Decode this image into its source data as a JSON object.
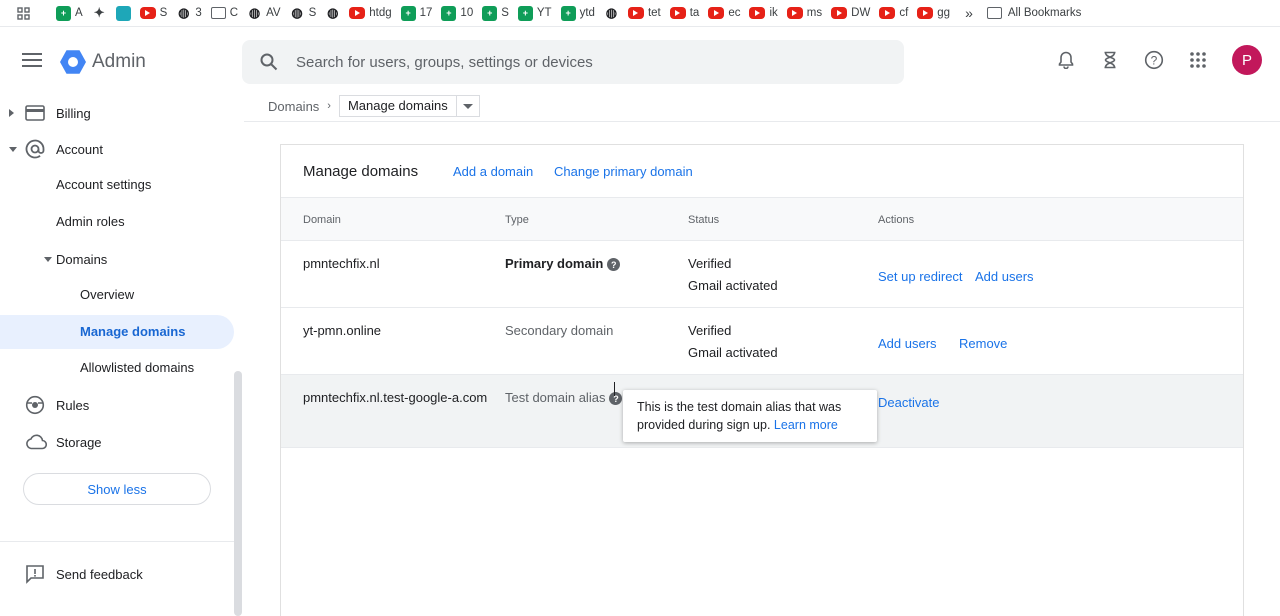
{
  "bookmarks": [
    {
      "icon": "sheet",
      "label": "A"
    },
    {
      "icon": "puzzle",
      "label": ""
    },
    {
      "icon": "teal",
      "label": ""
    },
    {
      "icon": "yt",
      "label": "S"
    },
    {
      "icon": "dark",
      "label": "3"
    },
    {
      "icon": "folder",
      "label": "C"
    },
    {
      "icon": "dark",
      "label": "AV"
    },
    {
      "icon": "dark",
      "label": "S"
    },
    {
      "icon": "dark",
      "label": ""
    },
    {
      "icon": "yt",
      "label": "htdg"
    },
    {
      "icon": "sheet",
      "label": "17"
    },
    {
      "icon": "sheet",
      "label": "10"
    },
    {
      "icon": "sheet",
      "label": "S"
    },
    {
      "icon": "sheet",
      "label": "YT"
    },
    {
      "icon": "sheet",
      "label": "ytd"
    },
    {
      "icon": "dark",
      "label": ""
    },
    {
      "icon": "yt",
      "label": "tet"
    },
    {
      "icon": "yt",
      "label": "ta"
    },
    {
      "icon": "yt",
      "label": "ec"
    },
    {
      "icon": "yt",
      "label": "ik"
    },
    {
      "icon": "yt",
      "label": "ms"
    },
    {
      "icon": "yt",
      "label": "DW"
    },
    {
      "icon": "yt",
      "label": "cf"
    },
    {
      "icon": "yt",
      "label": "gg"
    }
  ],
  "bookmarks_more": "»",
  "all_bookmarks": "All Bookmarks",
  "header": {
    "app_name": "Admin",
    "search_placeholder": "Search for users, groups, settings or devices",
    "avatar_letter": "P"
  },
  "breadcrumb": {
    "parent": "Domains",
    "current": "Manage domains"
  },
  "sidebar": {
    "billing": "Billing",
    "account": "Account",
    "account_settings": "Account settings",
    "admin_roles": "Admin roles",
    "domains": "Domains",
    "overview": "Overview",
    "manage_domains": "Manage domains",
    "allowlisted_domains": "Allowlisted domains",
    "rules": "Rules",
    "storage": "Storage",
    "show_less": "Show less",
    "send_feedback": "Send feedback"
  },
  "card": {
    "title": "Manage domains",
    "add_domain": "Add a domain",
    "change_primary": "Change primary domain",
    "columns": {
      "domain": "Domain",
      "type": "Type",
      "status": "Status",
      "actions": "Actions"
    },
    "rows": [
      {
        "domain": "pmntechfix.nl",
        "type": "Primary domain",
        "status1": "Verified",
        "status2": "Gmail activated",
        "action1": "Set up redirect",
        "action2": "Add users"
      },
      {
        "domain": "yt-pmn.online",
        "type": "Secondary domain",
        "status1": "Verified",
        "status2": "Gmail activated",
        "action1": "Add users",
        "action2": "Remove"
      },
      {
        "domain": "pmntechfix.nl.test-google-a.com",
        "type": "Test domain alias",
        "action1": "Deactivate"
      }
    ]
  },
  "tooltip": {
    "text": "This is the test domain alias that was provided during sign up.",
    "link": "Learn more"
  }
}
